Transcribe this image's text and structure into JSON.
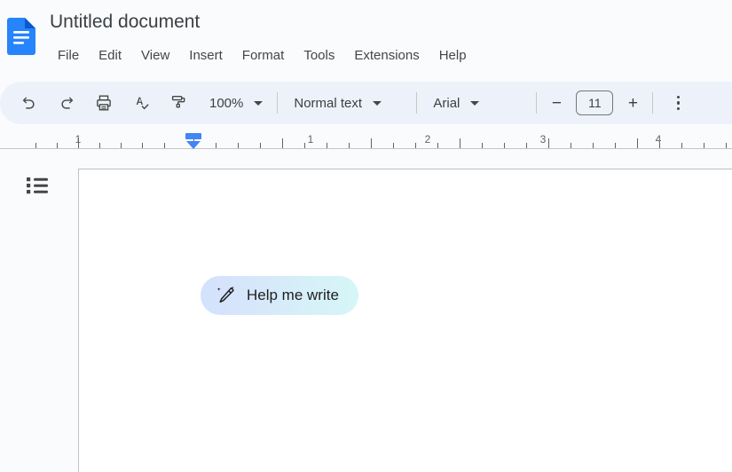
{
  "app": {
    "name": "Google Docs",
    "logo_icon": "docs-document-icon"
  },
  "header": {
    "title": "Untitled document",
    "menus": [
      {
        "label": "File"
      },
      {
        "label": "Edit"
      },
      {
        "label": "View"
      },
      {
        "label": "Insert"
      },
      {
        "label": "Format"
      },
      {
        "label": "Tools"
      },
      {
        "label": "Extensions"
      },
      {
        "label": "Help"
      }
    ]
  },
  "toolbar": {
    "undo_icon": "undo-icon",
    "redo_icon": "redo-icon",
    "print_icon": "print-icon",
    "spellcheck_icon": "spellcheck-icon",
    "paint_format_icon": "paint-format-icon",
    "zoom_value": "100%",
    "paragraph_style": "Normal text",
    "font_family": "Arial",
    "font_size": "11",
    "decrease_font_label": "−",
    "increase_font_label": "+",
    "overflow_icon": "more-options-icon"
  },
  "ruler": {
    "numbers": [
      "1",
      "1",
      "2",
      "3",
      "4"
    ],
    "left_indent_marker": "left-indent-marker"
  },
  "sidebar": {
    "outline_icon": "document-outline-icon"
  },
  "document": {
    "help_me_write": {
      "label": "Help me write",
      "icon": "magic-pencil-icon"
    }
  },
  "colors": {
    "brand_blue": "#1a73e8",
    "toolbar_bg": "#edf2fa",
    "canvas_bg": "#f9fbfd",
    "page_bg": "#ffffff",
    "ruler_marker": "#4285f4",
    "text_primary": "#3c4043"
  }
}
